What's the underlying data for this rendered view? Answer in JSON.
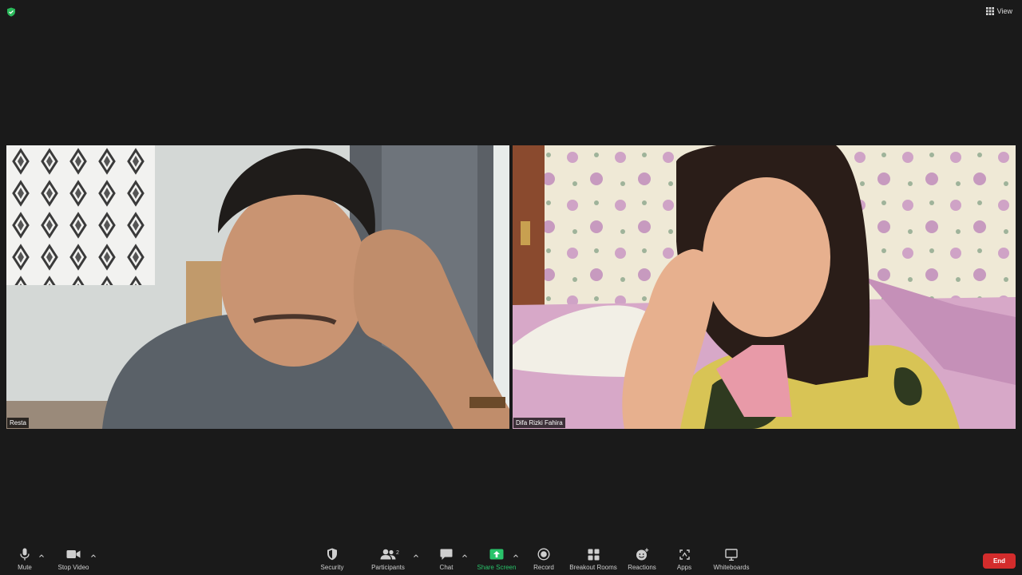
{
  "top_bar": {
    "view_label": "View"
  },
  "participants": [
    {
      "name": "Resta"
    },
    {
      "name": "Difa Rizki Fahira"
    }
  ],
  "toolbar": {
    "mute": "Mute",
    "stop_video": "Stop Video",
    "security": "Security",
    "participants": "Participants",
    "participants_count": "2",
    "chat": "Chat",
    "share_screen": "Share Screen",
    "record": "Record",
    "breakout_rooms": "Breakout Rooms",
    "reactions": "Reactions",
    "apps": "Apps",
    "whiteboards": "Whiteboards",
    "end": "End"
  },
  "colors": {
    "background": "#1a1a1a",
    "share_accent": "#29c36a",
    "end_button": "#d32c2c",
    "encryption_shield": "#2ab85a"
  },
  "icons": [
    "shield-check-icon",
    "grid-view-icon",
    "microphone-icon",
    "video-camera-icon",
    "security-shield-icon",
    "participants-icon",
    "chat-bubble-icon",
    "share-screen-icon",
    "record-icon",
    "breakout-rooms-icon",
    "reactions-icon",
    "apps-icon",
    "whiteboard-icon",
    "chevron-up-icon"
  ]
}
